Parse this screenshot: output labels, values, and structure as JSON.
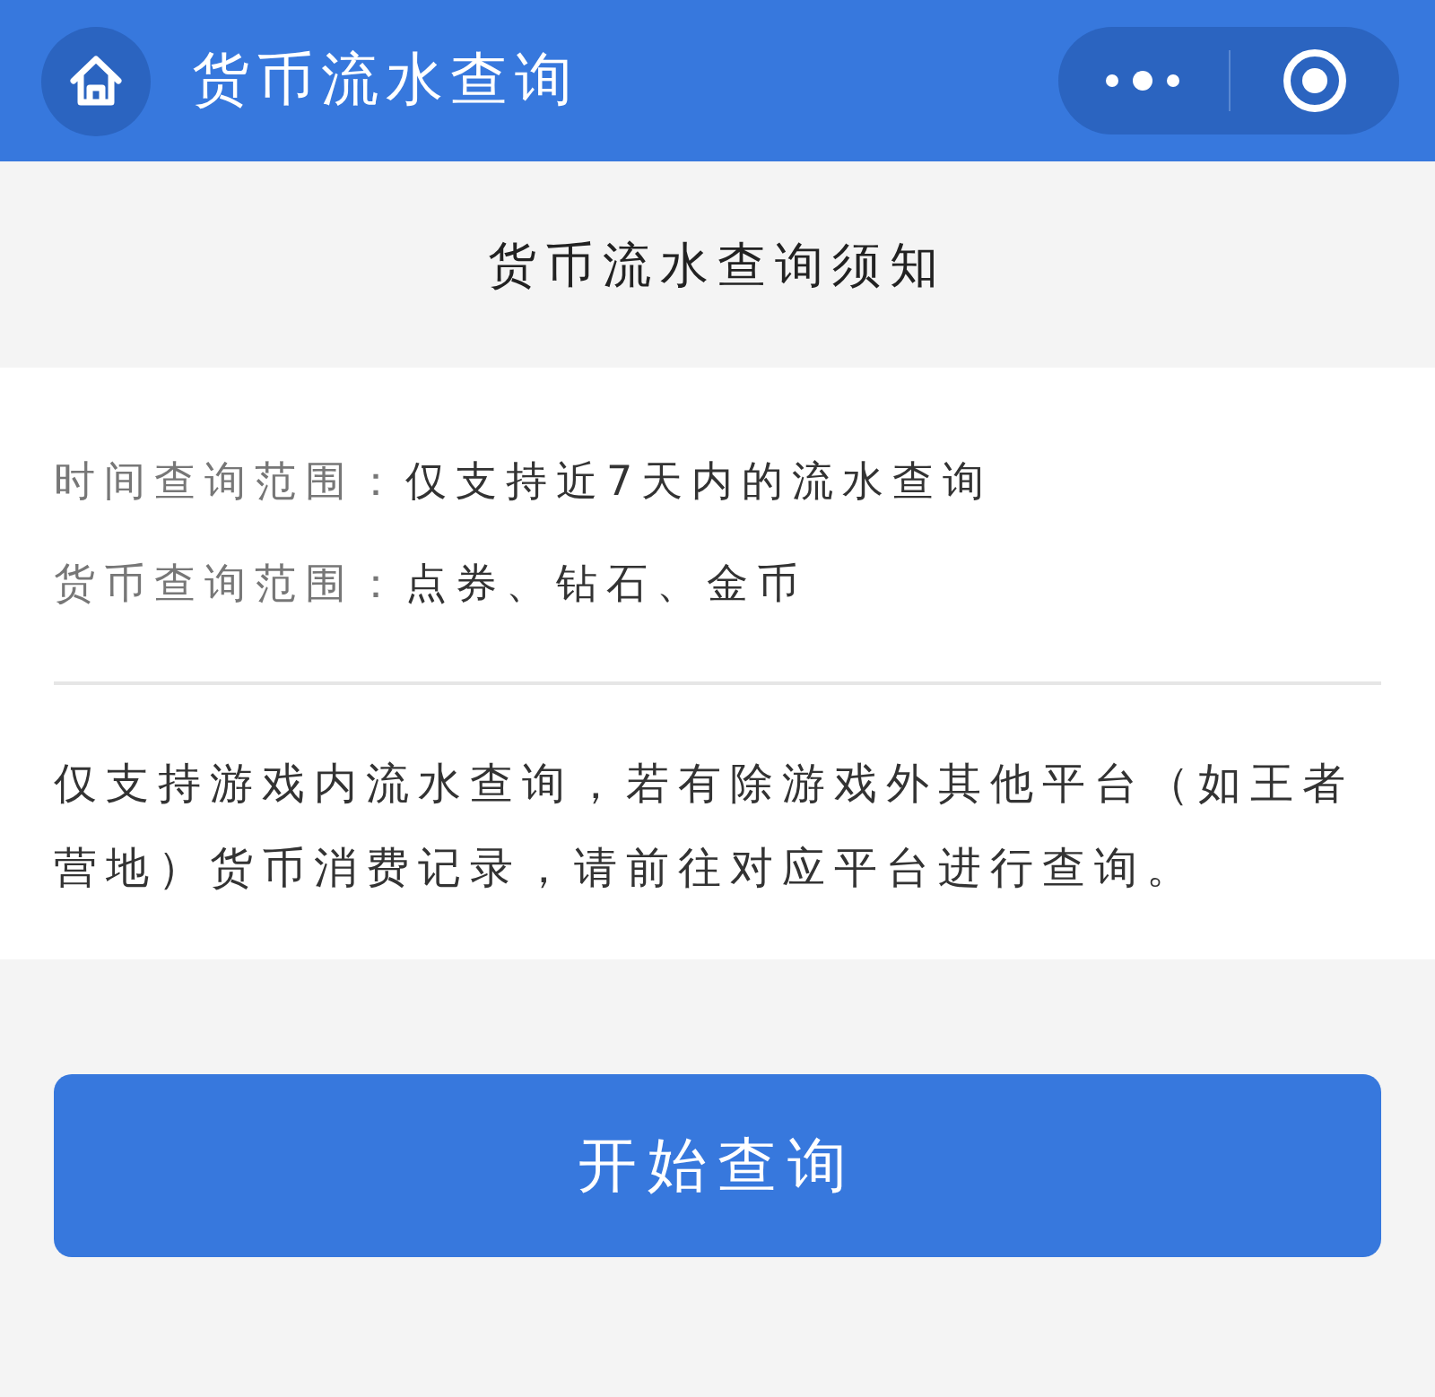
{
  "header": {
    "title": "货币流水查询"
  },
  "notice": {
    "title": "货币流水查询须知",
    "fields": [
      {
        "label": "时间查询范围：",
        "value": "仅支持近7天内的流水查询"
      },
      {
        "label": "货币查询范围：",
        "value": "点券、钻石、金币"
      }
    ],
    "note": "仅支持游戏内流水查询，若有除游戏外其他平台（如王者营地）货币消费记录，请前往对应平台进行查询。"
  },
  "button": {
    "label": "开始查询"
  }
}
